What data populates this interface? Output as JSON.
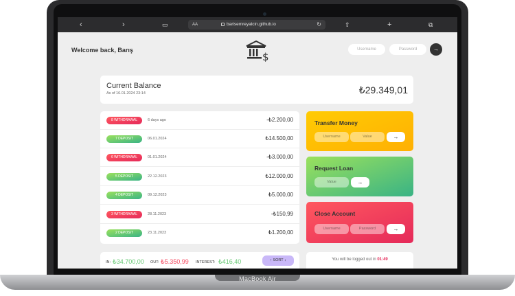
{
  "device": {
    "base_label": "MacBook Air"
  },
  "browser": {
    "url_aa": "AA",
    "url": "barisemreyalcin.github.io",
    "icons": [
      "back-icon",
      "forward-icon",
      "book-icon",
      "reload-icon",
      "share-icon",
      "plus-icon",
      "tabs-icon"
    ]
  },
  "header": {
    "welcome": "Welcome back, Barış",
    "logo": "bank-icon",
    "username_placeholder": "Username",
    "password_placeholder": "Password",
    "login_button": "→"
  },
  "balance": {
    "label": "Current Balance",
    "date": "As of 16.01.2024 23:14",
    "value": "₺29.349,01"
  },
  "movements": [
    {
      "type": "8 withdrawal",
      "kind": "withdrawal",
      "date": "6 days ago",
      "value": "-₺2.200,00"
    },
    {
      "type": "7 deposit",
      "kind": "deposit",
      "date": "06.01.2024",
      "value": "₺14.500,00"
    },
    {
      "type": "6 withdrawal",
      "kind": "withdrawal",
      "date": "01.01.2024",
      "value": "-₺3.000,00"
    },
    {
      "type": "5 deposit",
      "kind": "deposit",
      "date": "22.12.2023",
      "value": "₺12.000,00"
    },
    {
      "type": "4 deposit",
      "kind": "deposit",
      "date": "09.12.2023",
      "value": "₺5.000,00"
    },
    {
      "type": "3 withdrawal",
      "kind": "withdrawal",
      "date": "28.11.2023",
      "value": "-₺150,99"
    },
    {
      "type": "2 deposit",
      "kind": "deposit",
      "date": "23.11.2023",
      "value": "₺1.200,00"
    }
  ],
  "summary": {
    "in_label": "IN:",
    "in_value": "₺34.700,00",
    "out_label": "OUT:",
    "out_value": "₺5.350,99",
    "interest_label": "INTEREST:",
    "interest_value": "₺416,40",
    "sort_label": "↑ SORT ↓"
  },
  "operations": {
    "transfer": {
      "title": "Transfer Money",
      "input1": "Username",
      "input2": "Value",
      "button": "→"
    },
    "loan": {
      "title": "Request Loan",
      "input1": "Value",
      "button": "→"
    },
    "close": {
      "title": "Close Account",
      "input1": "Username",
      "input2": "Password",
      "button": "→"
    }
  },
  "logout": {
    "text": "You will be logged out in",
    "timer": "01:49"
  },
  "colors": {
    "withdrawal": "#e52a5a",
    "deposit": "#39b385",
    "transfer": "#ffcb03",
    "loan": "#39b385",
    "close": "#ff585f",
    "sort": "#c9b8f8"
  }
}
